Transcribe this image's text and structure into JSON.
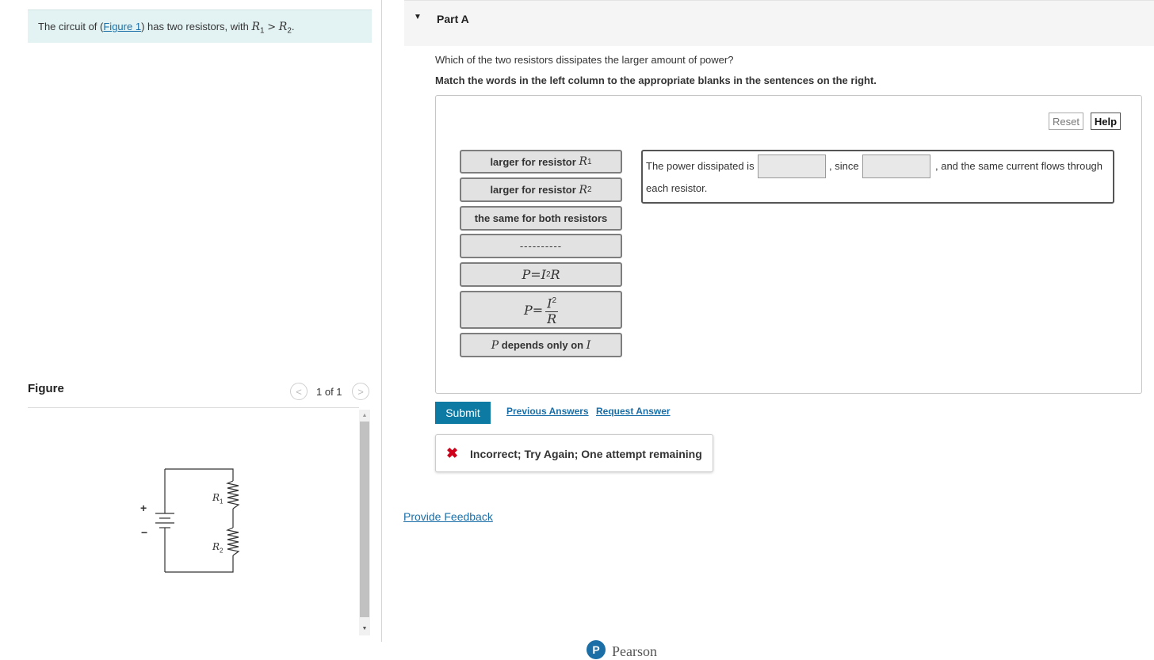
{
  "intro": {
    "prefix": "The circuit of (",
    "figure_link": "Figure 1",
    "suffix": ") has two resistors, with ",
    "r1": "R",
    "r1_sub": "1",
    "gt": ">",
    "r2": "R",
    "r2_sub": "2",
    "period": "."
  },
  "figure": {
    "title": "Figure",
    "pager": "1 of 1",
    "r1_label": "R",
    "r1_sub": "1",
    "r2_label": "R",
    "r2_sub": "2",
    "plus": "+",
    "minus": "−"
  },
  "part": {
    "title": "Part A",
    "question": "Which of the two resistors dissipates the larger amount of power?",
    "instruction": "Match the words in the left column to the appropriate blanks in the sentences on the right."
  },
  "toolbar": {
    "reset": "Reset",
    "help": "Help"
  },
  "chips": {
    "r1": {
      "text": "larger for resistor ",
      "var": "R",
      "sub": "1"
    },
    "r2": {
      "text": "larger for resistor ",
      "var": "R",
      "sub": "2"
    },
    "same": "the same for both resistors",
    "dashes": "----------",
    "i2r": {
      "p": "P",
      "eq": " = ",
      "i": "I",
      "exp": "2",
      "r": "R"
    },
    "i2overr": {
      "p": "P",
      "eq": " = ",
      "num_i": "I",
      "num_exp": "2",
      "den": "R"
    },
    "depends": {
      "p": "P",
      "text": " depends only on ",
      "i": "I"
    }
  },
  "sentence": {
    "part1": "The power dissipated is",
    "part2": ", since",
    "part3": ", and the same current flows through",
    "part4": "each resistor."
  },
  "actions": {
    "submit": "Submit",
    "previous_answers": "Previous Answers",
    "request_answer": "Request Answer",
    "provide_feedback": "Provide Feedback"
  },
  "feedback": {
    "icon": "✖",
    "message": "Incorrect; Try Again; One attempt remaining"
  },
  "footer": {
    "logo_letter": "P",
    "brand": "Pearson"
  },
  "colors": {
    "accent": "#0c7aa3",
    "link": "#1a6fa8",
    "intro_bg": "#e3f3f3",
    "error": "#d0021b"
  }
}
